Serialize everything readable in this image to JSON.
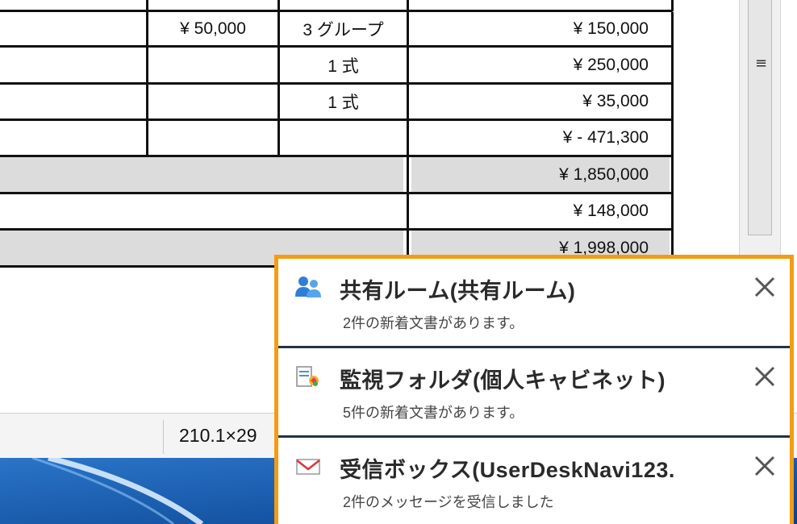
{
  "table": {
    "rows": [
      {
        "unit_price": "¥ 50,000",
        "quantity": "3 グループ",
        "amount": "¥ 150,000"
      },
      {
        "unit_price": "",
        "quantity": "1 式",
        "amount": "¥ 250,000"
      },
      {
        "unit_price": "",
        "quantity": "1 式",
        "amount": "¥ 35,000"
      },
      {
        "unit_price": "",
        "quantity": "",
        "amount": "¥ - 471,300"
      }
    ],
    "subtotal": "¥ 1,850,000",
    "tax": "¥ 148,000",
    "total": "¥ 1,998,000"
  },
  "statusbar": {
    "page_size": "210.1×29"
  },
  "notifications": [
    {
      "icon": "shared-room-icon",
      "title": "共有ルーム(共有ルーム)",
      "text": "2件の新着文書があります。"
    },
    {
      "icon": "watched-folder-icon",
      "title": "監視フォルダ(個人キャビネット)",
      "text": "5件の新着文書があります。"
    },
    {
      "icon": "mail-icon",
      "title": "受信ボックス(UserDeskNavi123.",
      "text": "2件のメッセージを受信しました"
    }
  ],
  "colors": {
    "popup_border": "#f39c12",
    "taskbar": "#1b5fb0",
    "gray_row": "#dcdcdc"
  }
}
